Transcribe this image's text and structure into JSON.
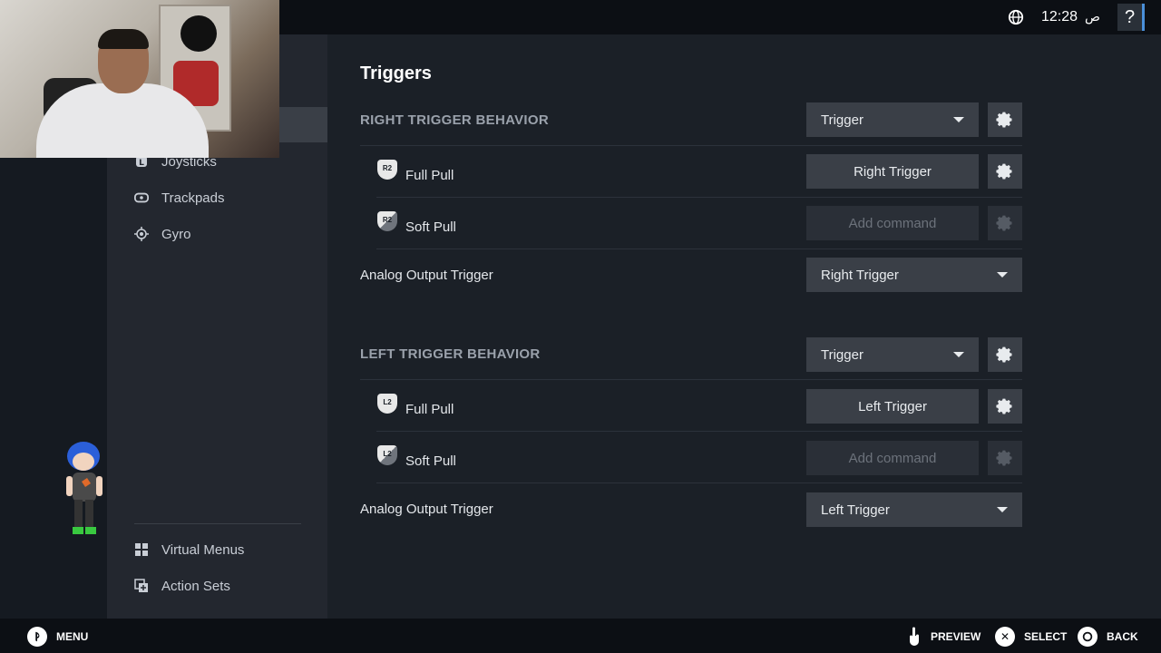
{
  "topbar": {
    "time": "12:28",
    "ampm": "ص",
    "help_label": "?"
  },
  "sidebar": {
    "items": [
      {
        "label": "Joysticks",
        "icon": "joystick-icon"
      },
      {
        "label": "Trackpads",
        "icon": "trackpad-icon"
      },
      {
        "label": "Gyro",
        "icon": "gyro-icon"
      }
    ],
    "bottom_items": [
      {
        "label": "Virtual Menus",
        "icon": "grid-icon"
      },
      {
        "label": "Action Sets",
        "icon": "action-sets-icon"
      }
    ]
  },
  "main": {
    "title": "Triggers",
    "right": {
      "heading": "RIGHT TRIGGER BEHAVIOR",
      "behavior_value": "Trigger",
      "full_pull": {
        "badge": "R2",
        "label": "Full Pull",
        "command": "Right Trigger"
      },
      "soft_pull": {
        "badge": "R2",
        "label": "Soft Pull",
        "command": "Add command"
      },
      "analog": {
        "label": "Analog Output Trigger",
        "value": "Right Trigger"
      }
    },
    "left": {
      "heading": "LEFT TRIGGER BEHAVIOR",
      "behavior_value": "Trigger",
      "full_pull": {
        "badge": "L2",
        "label": "Full Pull",
        "command": "Left Trigger"
      },
      "soft_pull": {
        "badge": "L2",
        "label": "Soft Pull",
        "command": "Add command"
      },
      "analog": {
        "label": "Analog Output Trigger",
        "value": "Left Trigger"
      }
    }
  },
  "bottombar": {
    "menu": "MENU",
    "preview": "PREVIEW",
    "select": "SELECT",
    "back": "BACK"
  },
  "colors": {
    "accent": "#4a8fd8",
    "panel": "#3a3f47",
    "background": "#1b2027"
  }
}
